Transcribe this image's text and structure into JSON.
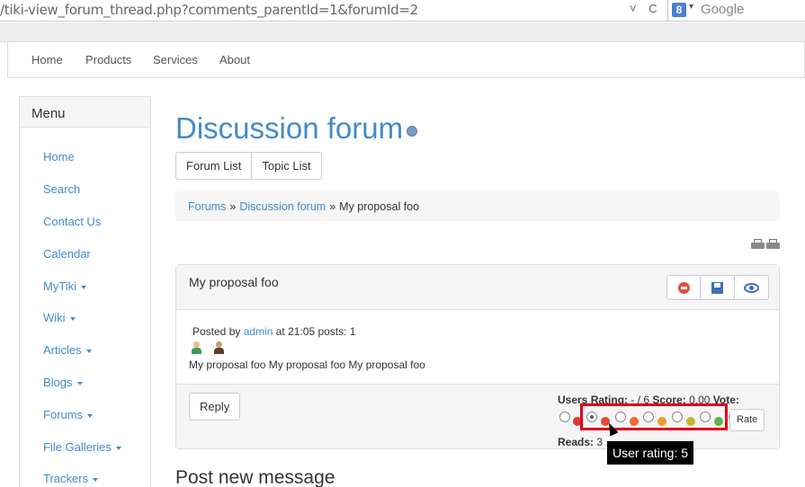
{
  "browser": {
    "url": "/tiki-view_forum_thread.php?comments_parentId=1&forumId=2",
    "url_controls": [
      "˅",
      "C"
    ],
    "search_engine_glyph": "8",
    "search_placeholder": "Google"
  },
  "topnav": {
    "items": [
      "Home",
      "Products",
      "Services",
      "About"
    ]
  },
  "sidebar": {
    "title": "Menu",
    "items": [
      {
        "label": "Home"
      },
      {
        "label": "Search"
      },
      {
        "label": "Contact Us"
      },
      {
        "label": "Calendar"
      },
      {
        "label": "MyTiki"
      },
      {
        "label": "Wiki"
      },
      {
        "label": "Articles"
      },
      {
        "label": "Blogs"
      },
      {
        "label": "Forums"
      },
      {
        "label": "File Galleries"
      },
      {
        "label": "Trackers"
      }
    ]
  },
  "page": {
    "title": "Discussion forum",
    "tabs": [
      "Forum List",
      "Topic List"
    ]
  },
  "breadcrumb": {
    "items": [
      "Forums",
      "Discussion forum",
      "My proposal foo"
    ],
    "separator": "»"
  },
  "post": {
    "title": "My proposal foo",
    "posted_by_label": "Posted by",
    "author": "admin",
    "at_time": "at 21:05 posts: 1",
    "body": "My proposal foo My proposal foo My proposal foo",
    "reply_label": "Reply",
    "rating_text_label": "Users Rating:",
    "rating_text_value": " - / 6 ",
    "score_label": "Score:",
    "score_value": " 0.00 ",
    "vote_label": "Vote:",
    "rate_label": "Rate",
    "reads_label": "Reads:",
    "reads_value": " 3",
    "tooltip": "User rating: 5",
    "selected_rating": 1
  },
  "section": {
    "new_message_title": "Post new message"
  },
  "colors": {
    "accent": "#428bca",
    "highlight": "#e0001b"
  }
}
